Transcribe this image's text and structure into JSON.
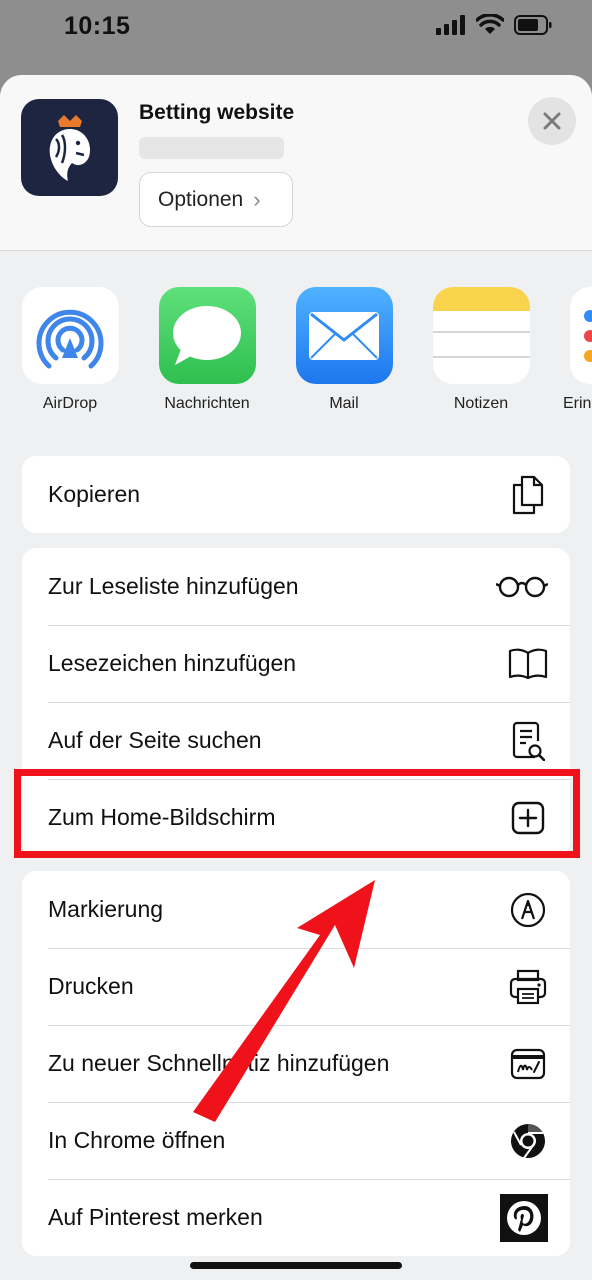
{
  "status_bar": {
    "time": "10:15"
  },
  "header": {
    "site_title": "Betting website",
    "options_label": "Optionen"
  },
  "share_targets": [
    {
      "label": "AirDrop",
      "icon": "airdrop-icon"
    },
    {
      "label": "Nachrichten",
      "icon": "messages-icon"
    },
    {
      "label": "Mail",
      "icon": "mail-icon"
    },
    {
      "label": "Notizen",
      "icon": "notes-icon"
    },
    {
      "label": "Erin",
      "icon": "reminders-icon"
    }
  ],
  "groups": [
    {
      "items": [
        {
          "label": "Kopieren",
          "icon": "copy-icon"
        }
      ]
    },
    {
      "items": [
        {
          "label": "Zur Leseliste hinzufügen",
          "icon": "glasses-icon"
        },
        {
          "label": "Lesezeichen hinzufügen",
          "icon": "book-icon"
        },
        {
          "label": "Auf der Seite suchen",
          "icon": "find-on-page-icon"
        },
        {
          "label": "Zum Home-Bildschirm",
          "icon": "add-square-icon"
        }
      ]
    },
    {
      "items": [
        {
          "label": "Markierung",
          "icon": "markup-icon"
        },
        {
          "label": "Drucken",
          "icon": "printer-icon"
        },
        {
          "label": "Zu neuer Schnellnotiz hinzufügen",
          "icon": "quick-note-icon"
        },
        {
          "label": "In Chrome öffnen",
          "icon": "chrome-icon"
        },
        {
          "label": "Auf Pinterest merken",
          "icon": "pinterest-icon"
        }
      ]
    }
  ],
  "colors": {
    "highlight": "#f0121a",
    "arrow": "#f0121a",
    "app_icon_bg": "#1e2540",
    "messages_green": "#34c759",
    "mail_blue": "#2f8cf5",
    "airdrop_blue": "#3f86ea"
  }
}
